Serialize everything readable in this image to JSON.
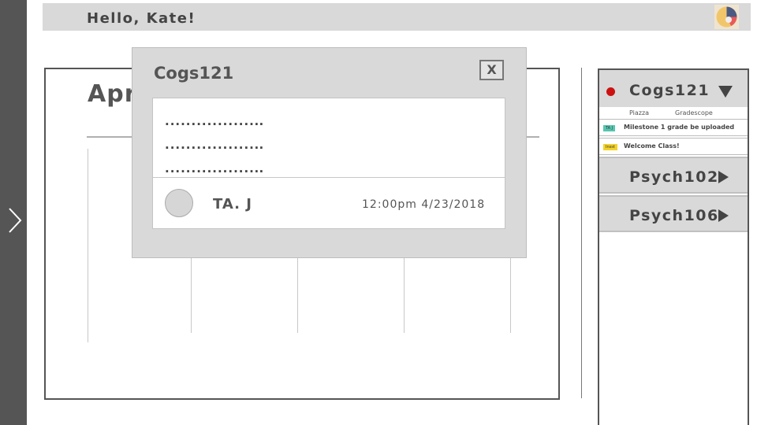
{
  "header": {
    "greeting": "Hello,  Kate!"
  },
  "calendar": {
    "month": "April"
  },
  "courses": [
    {
      "name": "Cogs121",
      "status_color": "#cc1111",
      "links": [
        "Piazza",
        "Gradescope"
      ],
      "announcements": [
        {
          "tag": "TA J",
          "tag_color": "#55c6b0",
          "text": "Milestone 1 grade be uploaded"
        },
        {
          "tag": "Insst",
          "tag_color": "#f2d22a",
          "text": "Welcome Class!"
        }
      ]
    },
    {
      "name": "Psych102"
    },
    {
      "name": "Psych106"
    }
  ],
  "modal": {
    "title": "Cogs121",
    "close_label": "X",
    "lines": [
      ".................․․",
      ".................․․",
      ".................․․"
    ],
    "author": "TA. J",
    "timestamp": "12:00pm 4/23/2018"
  },
  "icons": {
    "sidebar_toggle": "chevron-right-icon",
    "user_avatar": "user-avatar-icon",
    "expand": "triangle-down-icon",
    "collapse": "triangle-right-icon"
  }
}
